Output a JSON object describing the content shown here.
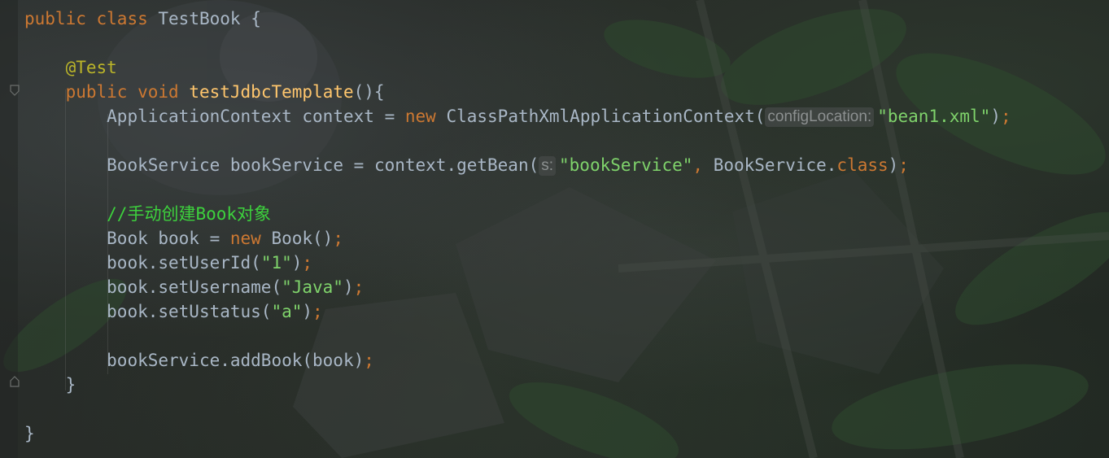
{
  "code": {
    "line1": {
      "kw1": "public",
      "kw2": "class",
      "name": "TestBook",
      "brace": "{"
    },
    "annotation": "@Test",
    "method": {
      "kw1": "public",
      "kw2": "void",
      "name": "testJdbcTemplate",
      "sig": "(){"
    },
    "line_context": {
      "type": "ApplicationContext",
      "var": "context",
      "eq": "=",
      "kw_new": "new",
      "ctor": "ClassPathXmlApplicationContext(",
      "hint": "configLocation:",
      "arg": "\"bean1.xml\"",
      "close": ")",
      "semi": ";"
    },
    "line_service": {
      "type": "BookService",
      "var": "bookService",
      "eq": "=",
      "call": "context.getBean(",
      "hint": "s:",
      "arg1": "\"bookService\"",
      "comma": ",",
      "cls": "BookService.",
      "kw_class": "class",
      "close": ")",
      "semi": ";"
    },
    "comment": "//手动创建Book对象",
    "line_book": {
      "decl": "Book book = ",
      "kw_new": "new",
      "ctor": "Book()",
      "semi": ";"
    },
    "set_user_id": {
      "call": "book.setUserId(",
      "arg": "\"1\"",
      "close": ")",
      "semi": ";"
    },
    "set_username": {
      "call": "book.setUsername(",
      "arg": "\"Java\"",
      "close": ")",
      "semi": ";"
    },
    "set_ustatus": {
      "call": "book.setUstatus(",
      "arg": "\"a\"",
      "close": ")",
      "semi": ";"
    },
    "add_book": {
      "call": "bookService.addBook(book)",
      "semi": ";"
    },
    "method_close": "}",
    "class_close": "}"
  },
  "colors": {
    "keyword": "#cc7832",
    "annotation": "#bbb529",
    "method_name": "#ffc66d",
    "string": "#6aab73",
    "comment": "#3dd13d",
    "identifier": "#a9b7c6",
    "param_hint": "#8c9090"
  }
}
